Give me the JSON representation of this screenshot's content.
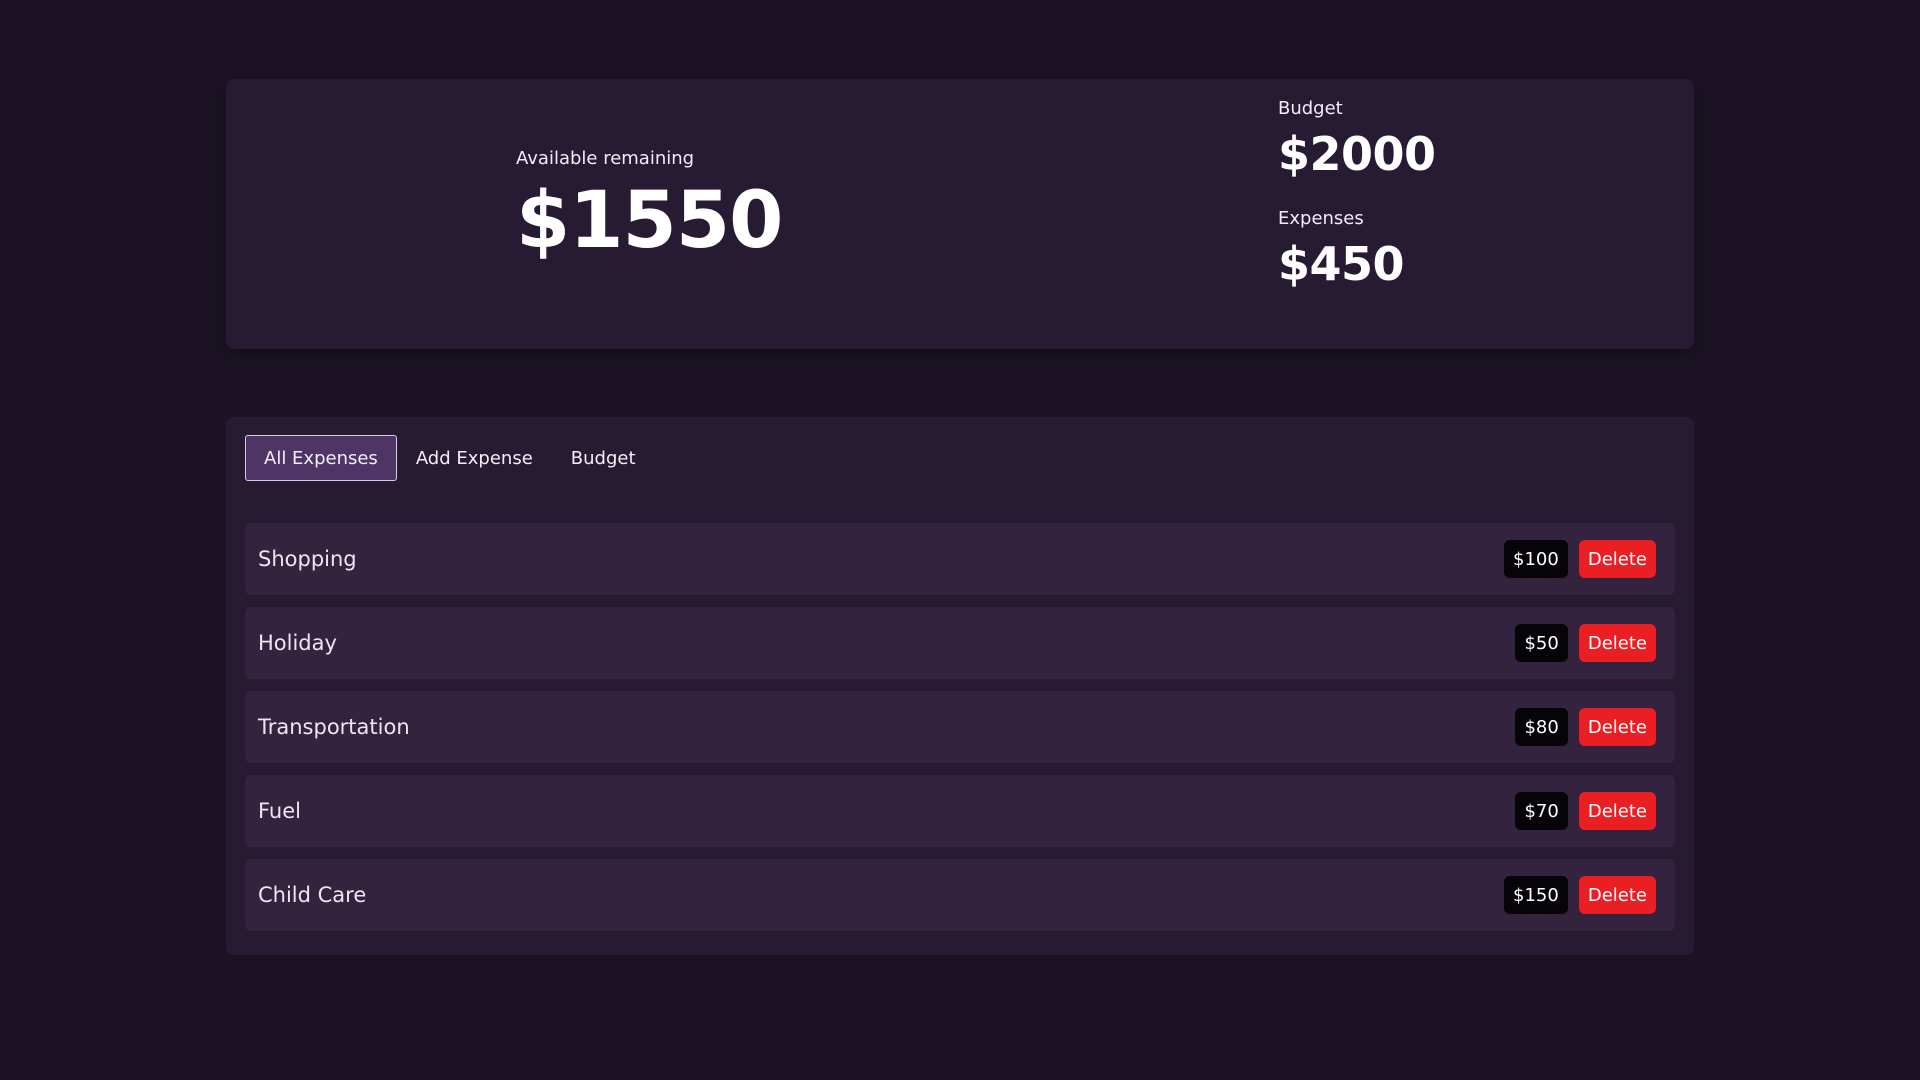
{
  "summary": {
    "remaining_label": "Available remaining",
    "remaining_value": "$1550",
    "budget_label": "Budget",
    "budget_value": "$2000",
    "expenses_label": "Expenses",
    "expenses_value": "$450"
  },
  "tabs": [
    {
      "label": "All Expenses",
      "active": true
    },
    {
      "label": "Add Expense",
      "active": false
    },
    {
      "label": "Budget",
      "active": false
    }
  ],
  "expenses": [
    {
      "name": "Shopping",
      "amount": "$100",
      "delete_label": "Delete"
    },
    {
      "name": "Holiday",
      "amount": "$50",
      "delete_label": "Delete"
    },
    {
      "name": "Transportation",
      "amount": "$80",
      "delete_label": "Delete"
    },
    {
      "name": "Fuel",
      "amount": "$70",
      "delete_label": "Delete"
    },
    {
      "name": "Child Care",
      "amount": "$150",
      "delete_label": "Delete"
    }
  ],
  "colors": {
    "background": "#1c1424",
    "card": "#271b33",
    "row": "#34233f",
    "active_tab": "#4f3466",
    "delete": "#ea1f24",
    "amount_pill": "#060408"
  }
}
